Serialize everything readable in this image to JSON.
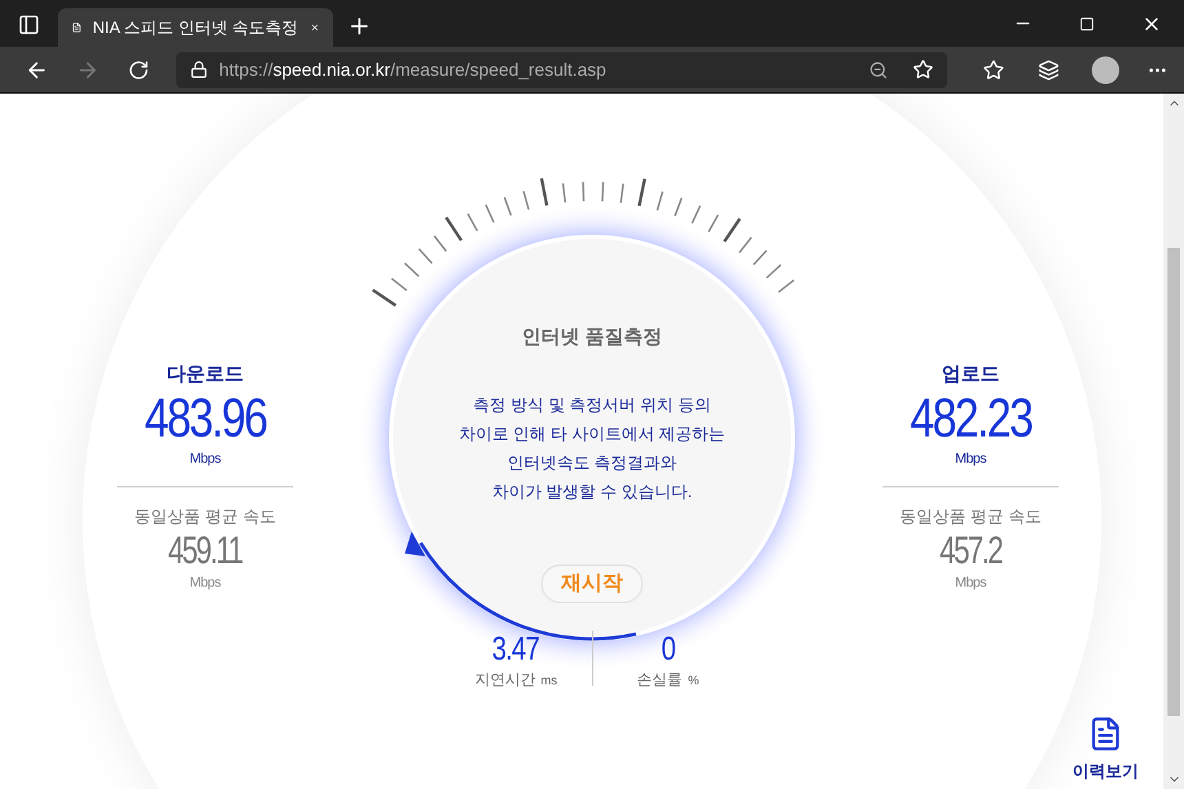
{
  "browser": {
    "tab_title": "NIA 스피드 인터넷 속도측정",
    "url": "https://**speed.nia.or.kr**/measure/speed_result.asp"
  },
  "download": {
    "label": "다운로드",
    "value": "483.96",
    "unit": "Mbps",
    "avg_label": "동일상품 평균 속도",
    "avg_value": "459.11",
    "avg_unit": "Mbps"
  },
  "upload": {
    "label": "업로드",
    "value": "482.23",
    "unit": "Mbps",
    "avg_label": "동일상품 평균 속도",
    "avg_value": "457.2",
    "avg_unit": "Mbps"
  },
  "center": {
    "title": "인터넷 품질측정",
    "notice": [
      "측정 방식 및 측정서버 위치 등의",
      "차이로 인해 타 사이트에서 제공하는",
      "인터넷속도 측정결과와",
      "차이가 발생할 수 있습니다."
    ],
    "restart": "재시작"
  },
  "latency": {
    "value": "3.47",
    "label": "지연시간",
    "unit": "ms"
  },
  "loss": {
    "value": "0",
    "label": "손실률",
    "unit": "%"
  },
  "history": {
    "label": "이력보기"
  }
}
